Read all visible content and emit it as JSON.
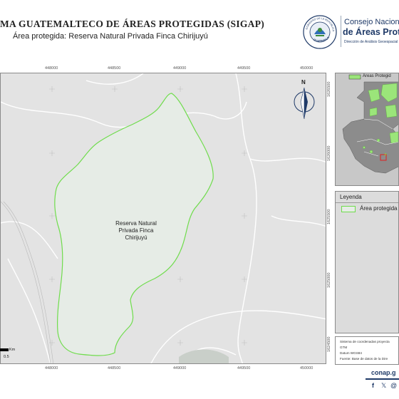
{
  "header": {
    "title": "MA GUATEMALTECO DE ÁREAS PROTEGIDAS  (SIGAP)",
    "subtitle": "Área protegida: Reserva Natural Privada Finca Chirijuyú",
    "seal_text_top": "GOBIERNO DE LA REPÚBLICA",
    "seal_text_bottom": "GUATEMALA",
    "brand_line1": "Consejo Nacional",
    "brand_line2": "de Áreas Protegid",
    "brand_line3": "Dirección de Análisis Geoespacial"
  },
  "map": {
    "area_label_lines": [
      "Reserva Natural",
      "Privada Finca",
      "Chirijuyú"
    ],
    "north_label": "N",
    "x_ticks": [
      "448000",
      "448500",
      "449000",
      "449500",
      "450000"
    ],
    "y_ticks": [
      "1626500",
      "1626000",
      "1625500",
      "1625000",
      "1624500"
    ],
    "scale_unit": "Km",
    "scale_value": "0.5",
    "colors": {
      "area_outline": "#6fdc4c",
      "area_fill": "#e6ece6",
      "background": "#e3e3e3",
      "roads": "#ffffff",
      "pointer": "#e02020"
    }
  },
  "locator": {
    "legend_label": "Áreas Protegid",
    "colors": {
      "land": "#8c8c8c",
      "protected": "#9be57a",
      "sea": "#c8c8c8"
    }
  },
  "legend": {
    "title": "Leyenda",
    "item_label": "Área protegida"
  },
  "info": {
    "lines": [
      "Sistema de coordenadas proyecta",
      "GTM",
      "Datum WGS84",
      "Fuente: Base de datos de la Dire"
    ]
  },
  "footer": {
    "url": "conap.g",
    "social_icons": [
      "facebook-icon",
      "x-icon",
      "at-icon"
    ],
    "social_glyphs": [
      "f",
      "𝕏",
      "@"
    ]
  }
}
